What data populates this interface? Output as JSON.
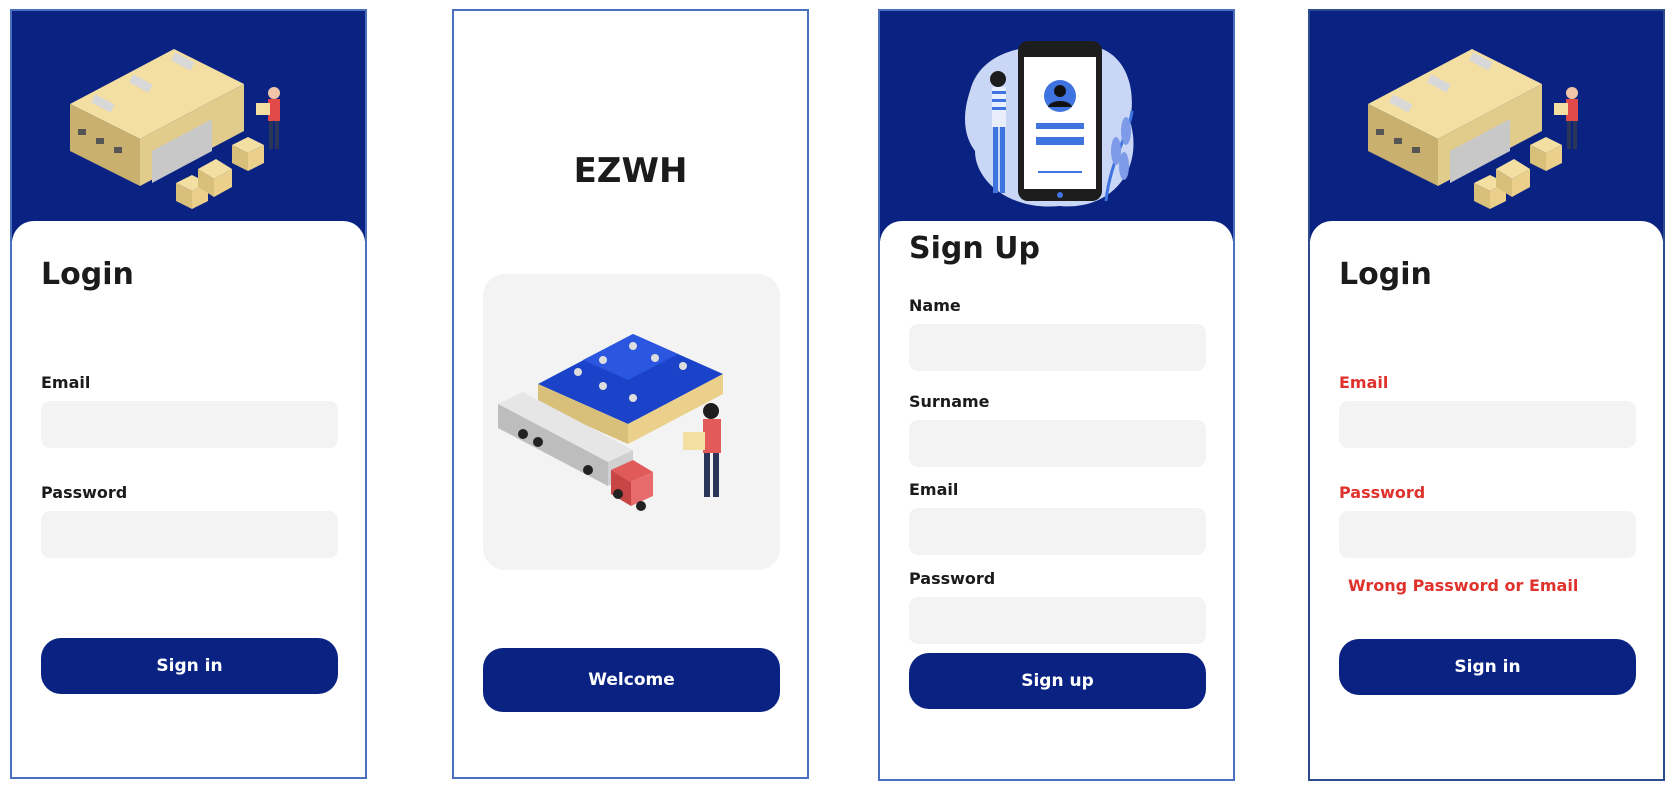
{
  "screens": {
    "login": {
      "title": "Login",
      "email_label": "Email",
      "password_label": "Password",
      "button": "Sign in"
    },
    "welcome": {
      "app_name": "EZWH",
      "button": "Welcome"
    },
    "signup": {
      "title": "Sign Up",
      "name_label": "Name",
      "surname_label": "Surname",
      "email_label": "Email",
      "password_label": "Password",
      "button": "Sign up"
    },
    "login_error": {
      "title": "Login",
      "email_label": "Email",
      "password_label": "Password",
      "error_message": "Wrong Password or Email",
      "button": "Sign in"
    }
  },
  "colors": {
    "primary": "#0a2382",
    "error": "#e0322d",
    "field_bg": "#f3f3f3",
    "frame_border": "#4a6fbf"
  },
  "icons": [
    "warehouse-illustration",
    "warehouse-truck-illustration",
    "phone-profile-illustration"
  ]
}
